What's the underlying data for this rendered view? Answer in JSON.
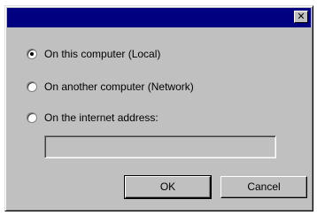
{
  "window": {
    "close_glyph": "✕"
  },
  "options": [
    {
      "label": "On this computer (Local)",
      "checked": true
    },
    {
      "label": "On another computer (Network)",
      "checked": false
    },
    {
      "label": "On the internet address:",
      "checked": false
    }
  ],
  "address_input": {
    "value": "",
    "enabled": false
  },
  "buttons": {
    "ok_label": "OK",
    "cancel_label": "Cancel"
  }
}
